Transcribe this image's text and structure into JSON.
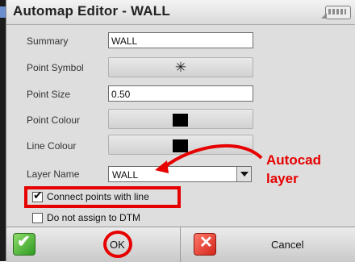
{
  "window": {
    "title": "Automap Editor - WALL",
    "keyboard_icon": "keyboard-icon"
  },
  "fields": {
    "summary": {
      "label": "Summary",
      "value": "WALL"
    },
    "point_symbol": {
      "label": "Point Symbol",
      "symbol": "✳",
      "icon": "asterisk-symbol-icon"
    },
    "point_size": {
      "label": "Point Size",
      "value": "0.50"
    },
    "point_colour": {
      "label": "Point Colour",
      "color": "#000000"
    },
    "line_colour": {
      "label": "Line Colour",
      "color": "#000000"
    },
    "layer_name": {
      "label": "Layer Name",
      "value": "WALL"
    }
  },
  "options": {
    "connect_points": {
      "label": "Connect points with line",
      "checked": true
    },
    "do_not_assign_dtm": {
      "label": "Do not assign to DTM",
      "checked": false
    }
  },
  "annotation": {
    "line1": "Autocad",
    "line2": "layer",
    "color": "#e60000"
  },
  "buttons": {
    "ok": "OK",
    "cancel": "Cancel"
  }
}
